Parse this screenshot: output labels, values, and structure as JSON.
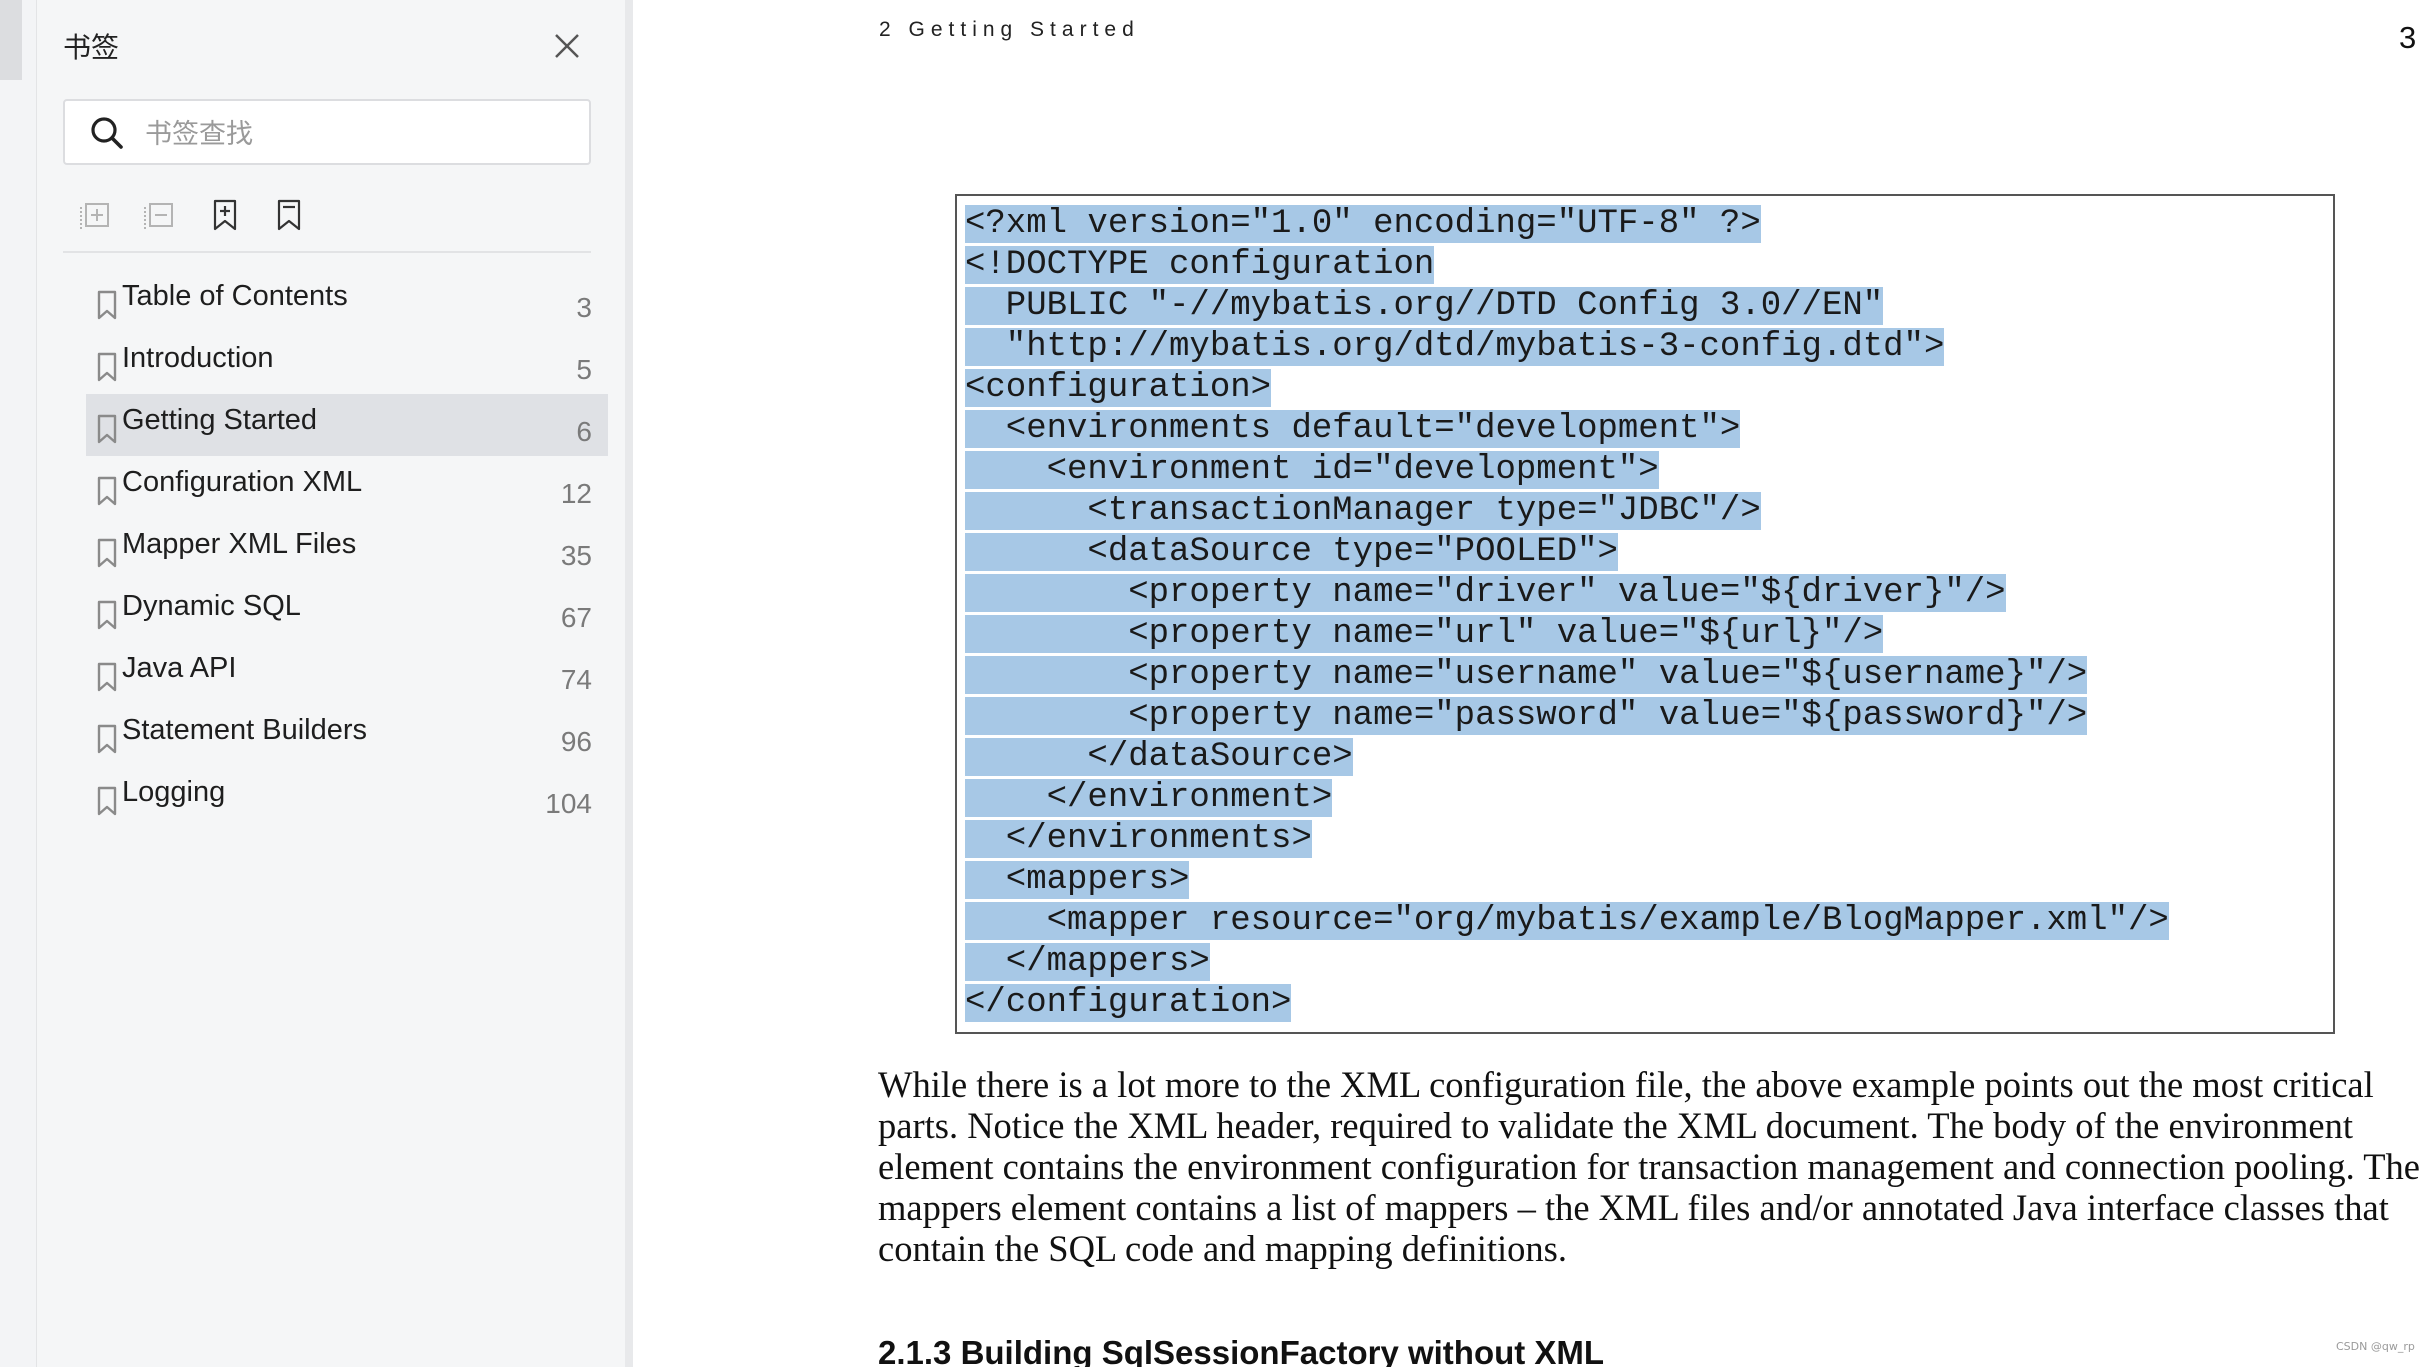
{
  "sidebar_panel": {
    "title": "书签",
    "search_placeholder": "书签查找",
    "toolbar": {
      "expand_icon": "expand-all-icon",
      "collapse_icon": "collapse-all-icon",
      "add_icon": "add-bookmark-icon",
      "bookmark_icon": "bookmark-icon"
    },
    "bookmarks": [
      {
        "label": "Table of Contents",
        "page": "3"
      },
      {
        "label": "Introduction",
        "page": "5"
      },
      {
        "label": "Getting Started",
        "page": "6",
        "active": true
      },
      {
        "label": "Configuration XML",
        "page": "12"
      },
      {
        "label": "Mapper XML Files",
        "page": "35"
      },
      {
        "label": "Dynamic SQL",
        "page": "67"
      },
      {
        "label": "Java API",
        "page": "74"
      },
      {
        "label": "Statement Builders",
        "page": "96"
      },
      {
        "label": "Logging",
        "page": "104"
      }
    ]
  },
  "document": {
    "running_header": "2 Getting Started",
    "page_number": "3",
    "code_lines": [
      "<?xml version=\"1.0\" encoding=\"UTF-8\" ?>",
      "<!DOCTYPE configuration",
      "  PUBLIC \"-//mybatis.org//DTD Config 3.0//EN\"",
      "  \"http://mybatis.org/dtd/mybatis-3-config.dtd\">",
      "<configuration>",
      "  <environments default=\"development\">",
      "    <environment id=\"development\">",
      "      <transactionManager type=\"JDBC\"/>",
      "      <dataSource type=\"POOLED\">",
      "        <property name=\"driver\" value=\"${driver}\"/>",
      "        <property name=\"url\" value=\"${url}\"/>",
      "        <property name=\"username\" value=\"${username}\"/>",
      "        <property name=\"password\" value=\"${password}\"/>",
      "      </dataSource>",
      "    </environment>",
      "  </environments>",
      "  <mappers>",
      "    <mapper resource=\"org/mybatis/example/BlogMapper.xml\"/>",
      "  </mappers>",
      "</configuration>"
    ],
    "paragraph": "While there is a lot more to the XML configuration file, the above example points out the most critical parts. Notice the XML header, required to validate the XML document. The body of the environment element contains the environment configuration for transaction management and connection pooling. The mappers element contains a list of mappers – the XML files and/or annotated Java interface classes that contain the SQL code and mapping definitions.",
    "section_heading": "2.1.3 Building SqlSessionFactory without XML"
  },
  "watermark": "CSDN @qw_rp",
  "colors": {
    "selection_highlight": "#a7c8e6",
    "panel_background": "#f5f6f7",
    "active_bookmark": "#dfe1e5"
  }
}
